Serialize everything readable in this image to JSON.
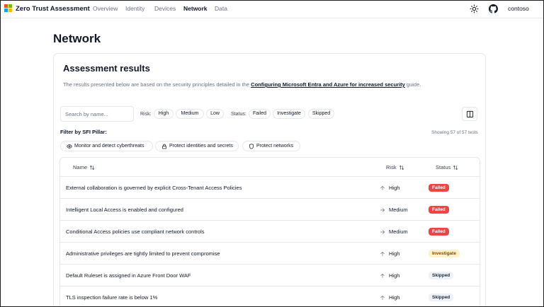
{
  "app": {
    "title": "Zero Trust Assessment",
    "nav": [
      "Overview",
      "Identity",
      "Devices",
      "Network",
      "Data"
    ],
    "active_nav": "Network",
    "tenant": "contoso",
    "colors": {
      "ms_red": "#f25022",
      "ms_green": "#7fba00",
      "ms_blue": "#00a4ef",
      "ms_yellow": "#ffb900"
    }
  },
  "page": {
    "title": "Network"
  },
  "results": {
    "title": "Assessment results",
    "desc_pre": "The results presented below are based on the security principles detailed in the ",
    "desc_link": "Configuring Microsoft Entra and Azure for increased security",
    "desc_post": " guide.",
    "search_placeholder": "Search by name...",
    "risk_label": "Risk:",
    "risk_filters": [
      "High",
      "Medium",
      "Low"
    ],
    "status_label": "Status:",
    "status_filters": [
      "Failed",
      "Investigate",
      "Skipped"
    ],
    "pillar_label": "Filter by SFI Pillar:",
    "showing": "Showing 57 of 57 tests",
    "pillars": [
      {
        "label": "Monitor and detect cyberthreats",
        "icon": "eye-icon"
      },
      {
        "label": "Protect identities and secrets",
        "icon": "lock-icon"
      },
      {
        "label": "Protect networks",
        "icon": "shield-icon"
      }
    ]
  },
  "table": {
    "headers": {
      "name": "Name",
      "risk": "Risk",
      "status": "Status"
    },
    "rows": [
      {
        "name": "External collaboration is governed by explicit Cross-Tenant Access Policies",
        "risk": "High",
        "status": "Failed"
      },
      {
        "name": "Intelligent Local Access is enabled and configured",
        "risk": "Medium",
        "status": "Failed"
      },
      {
        "name": "Conditional Access policies use compliant network controls",
        "risk": "Medium",
        "status": "Failed"
      },
      {
        "name": "Administrative privileges are tightly limited to prevent compromise",
        "risk": "High",
        "status": "Investigate"
      },
      {
        "name": "Default Ruleset is assigned in Azure Front Door WAF",
        "risk": "High",
        "status": "Skipped"
      },
      {
        "name": "TLS inspection failure rate is below 1%",
        "risk": "High",
        "status": "Skipped"
      }
    ],
    "status_colors": {
      "Failed": {
        "bg": "#ef4444",
        "fg": "#ffffff"
      },
      "Investigate": {
        "bg": "#fef3c7",
        "fg": "#92400e"
      },
      "Skipped": {
        "bg": "#eef2f7",
        "fg": "#1f2937"
      }
    }
  }
}
